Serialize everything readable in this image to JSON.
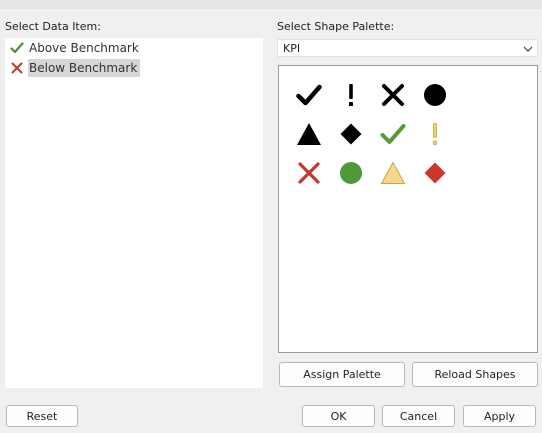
{
  "left_panel": {
    "label": "Select Data Item:",
    "items": [
      {
        "label": "Above Benchmark",
        "icon": "green-check-icon",
        "color": "#4e8a3e",
        "selected": false
      },
      {
        "label": "Below Benchmark",
        "icon": "red-x-icon",
        "color": "#c0392b",
        "selected": true
      }
    ]
  },
  "right_panel": {
    "label": "Select Shape Palette:",
    "palette_value": "KPI",
    "shapes": [
      {
        "name": "black-check-icon",
        "color": "#000000"
      },
      {
        "name": "black-exclamation-icon",
        "color": "#000000"
      },
      {
        "name": "black-x-icon",
        "color": "#000000"
      },
      {
        "name": "black-circle-icon",
        "color": "#000000"
      },
      {
        "name": "black-triangle-icon",
        "color": "#000000"
      },
      {
        "name": "black-diamond-icon",
        "color": "#000000"
      },
      {
        "name": "green-check-icon",
        "color": "#5a9a3c"
      },
      {
        "name": "yellow-exclamation-icon",
        "color": "#f0d078"
      },
      {
        "name": "red-x-icon",
        "color": "#c0392b"
      },
      {
        "name": "green-circle-icon",
        "color": "#4e9a3a"
      },
      {
        "name": "yellow-triangle-icon",
        "color": "#f6d88a"
      },
      {
        "name": "red-diamond-icon",
        "color": "#d0352b"
      }
    ]
  },
  "buttons": {
    "assign_palette": "Assign Palette",
    "reload_shapes": "Reload Shapes",
    "reset": "Reset",
    "ok": "OK",
    "cancel": "Cancel",
    "apply": "Apply"
  }
}
